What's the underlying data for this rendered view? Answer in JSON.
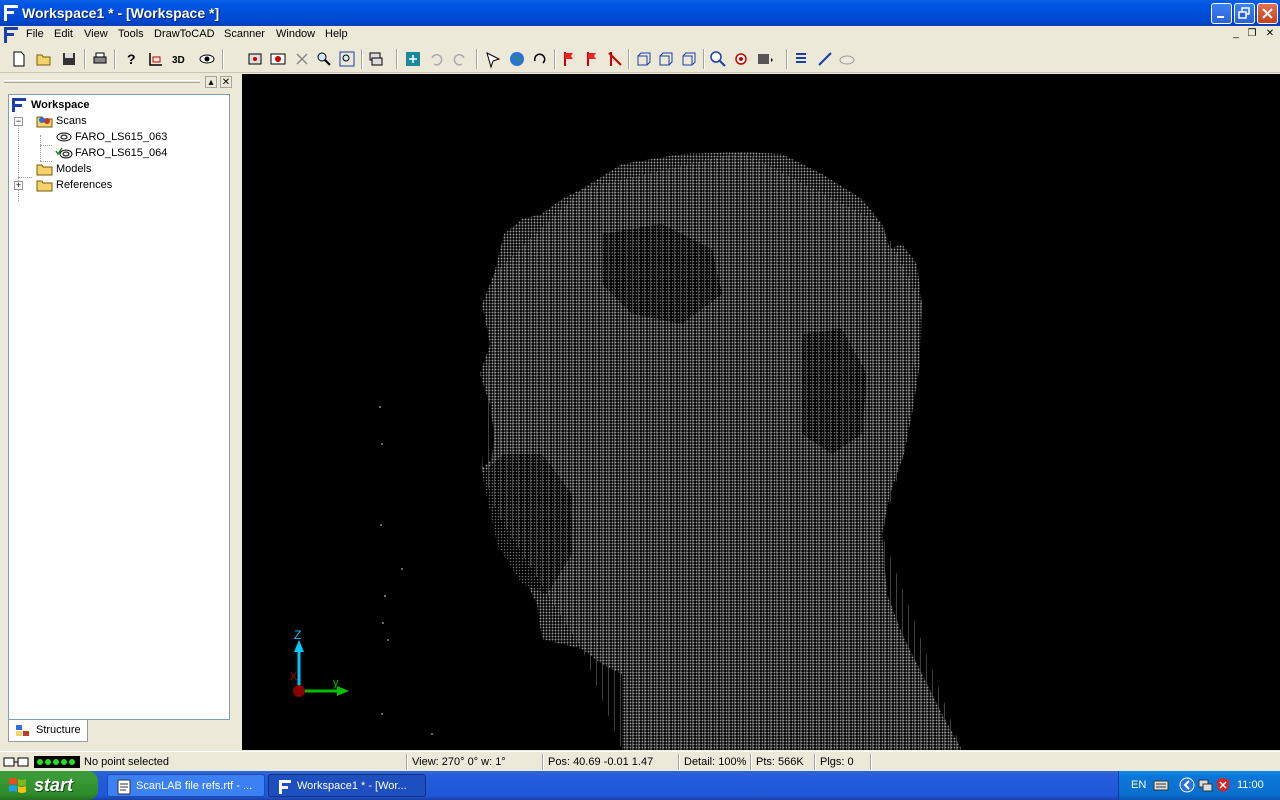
{
  "window": {
    "title": "Workspace1 * - [Workspace *]",
    "controls": [
      "minimize",
      "restore",
      "close"
    ]
  },
  "menubar": {
    "items": [
      "File",
      "Edit",
      "View",
      "Tools",
      "DrawToCAD",
      "Scanner",
      "Window",
      "Help"
    ]
  },
  "toolbar": {
    "icons": [
      "new-icon",
      "open-icon",
      "save-icon",
      "print-icon",
      "help-icon",
      "measure-icon",
      "3d-label-icon",
      "eye-icon",
      "scan-icon",
      "camera-icon",
      "cut-icon",
      "zoom-fit-icon",
      "zoom-window-icon",
      "layers-icon",
      "move-icon",
      "undo-icon",
      "redo-icon",
      "select-icon",
      "globe-icon",
      "rotate-icon",
      "flag-icon",
      "flag-add-icon",
      "flag-remove-icon",
      "box-front-icon",
      "box-side-icon",
      "box-top-icon",
      "zoom-in-icon",
      "look-icon",
      "grid-icon",
      "list-icon",
      "line-icon",
      "cloud-icon"
    ],
    "three_d_label": "3D"
  },
  "tree": {
    "root": "Workspace",
    "scans_folder": "Scans",
    "scans": [
      "FARO_LS615_063",
      "FARO_LS615_064"
    ],
    "models_folder": "Models",
    "references_folder": "References"
  },
  "panel": {
    "tab_label": "Structure"
  },
  "view": {
    "axis_z": "Z",
    "axis_y": "y",
    "axis_x": "X",
    "colors": {
      "background": "#000000",
      "points": "#8a8a8a",
      "z_axis": "#00c8ff",
      "y_axis": "#00c000",
      "x_axis": "#c00000"
    }
  },
  "status": {
    "message": "No point selected",
    "view": "View: 270° 0° w: 1°",
    "pos": "Pos:  40.69  -0.01   1.47",
    "detail": "Detail: 100%",
    "pts": "Pts: 566K",
    "plgs": "Plgs:    0"
  },
  "taskbar": {
    "start": "start",
    "tasks": [
      "ScanLAB file refs.rtf - ...",
      "Workspace1 * - [Wor..."
    ],
    "lang": "EN",
    "clock": "11:00"
  }
}
